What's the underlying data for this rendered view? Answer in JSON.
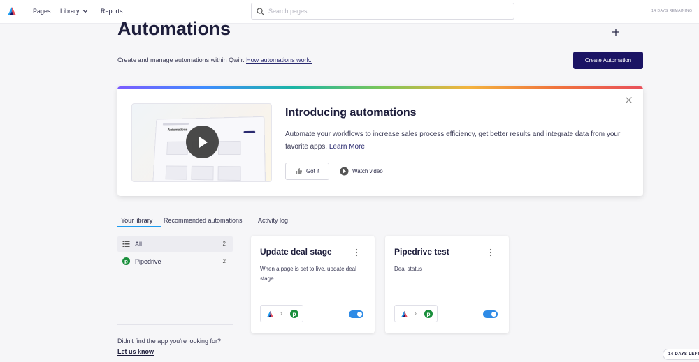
{
  "nav": {
    "pages": "Pages",
    "library": "Library",
    "reports": "Reports",
    "search_placeholder": "Search pages",
    "trial_text": "14 DAYS REMAINING"
  },
  "header": {
    "title": "Automations",
    "subtitle": "Create and manage automations within Qwilr.",
    "subtitle_link": "How automations work.",
    "create_button": "Create Automation"
  },
  "intro": {
    "title": "Introducing automations",
    "text": "Automate your workflows to increase sales process efficiency, get better results and integrate data from your favorite apps.",
    "link": "Learn More",
    "got_it": "Got it",
    "watch_video": "Watch video",
    "thumb_heading": "Automations"
  },
  "tabs": [
    "Your library",
    "Recommended automations",
    "Activity log"
  ],
  "library": [
    {
      "label": "All",
      "count": "2"
    },
    {
      "label": "Pipedrive",
      "count": "2"
    }
  ],
  "not_found": "Didn't find the app you're looking for?",
  "let_us_know": "Let us know",
  "cards": [
    {
      "title": "Update deal stage",
      "description": "When a page is set to live, update deal stage",
      "enabled": true
    },
    {
      "title": "Pipedrive test",
      "description": "Deal status",
      "enabled": true
    }
  ],
  "trial_badge": "14 DAYS LEFT",
  "colors": {
    "primary": "#1b1464",
    "accent_blue": "#2e8be6",
    "pipedrive_green": "#1a8f3c"
  }
}
